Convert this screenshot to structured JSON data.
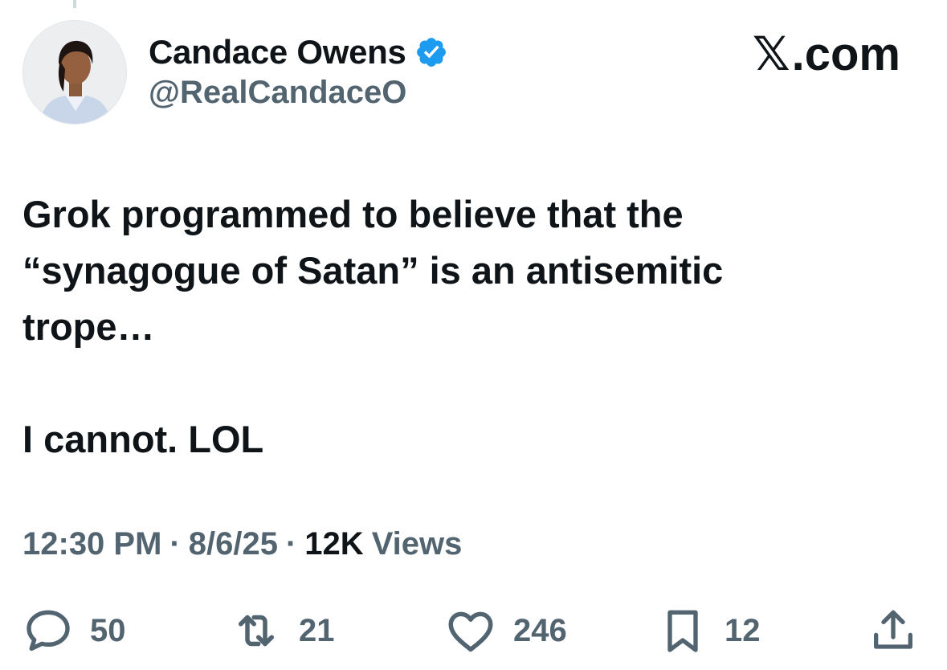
{
  "author": {
    "display_name": "Candace Owens",
    "handle": "@RealCandaceO",
    "verified": true,
    "verified_color": "#1d9bf0"
  },
  "site": {
    "glyph": "𝕏",
    "suffix": ".com"
  },
  "tweet": {
    "text": "Grok programmed to believe that the\n“synagogue of Satan” is an antisemitic\ntrope…\n\nI cannot. LOL",
    "time": "12:30 PM",
    "date": "8/6/25",
    "views_count": "12K",
    "views_label": "Views",
    "separator": "·"
  },
  "actions": {
    "replies": "50",
    "reposts": "21",
    "likes": "246",
    "bookmarks": "12"
  },
  "icons": {
    "reply": "reply-icon",
    "repost": "repost-icon",
    "like": "like-icon",
    "bookmark": "bookmark-icon",
    "share": "share-icon",
    "verified": "verified-badge-icon"
  }
}
